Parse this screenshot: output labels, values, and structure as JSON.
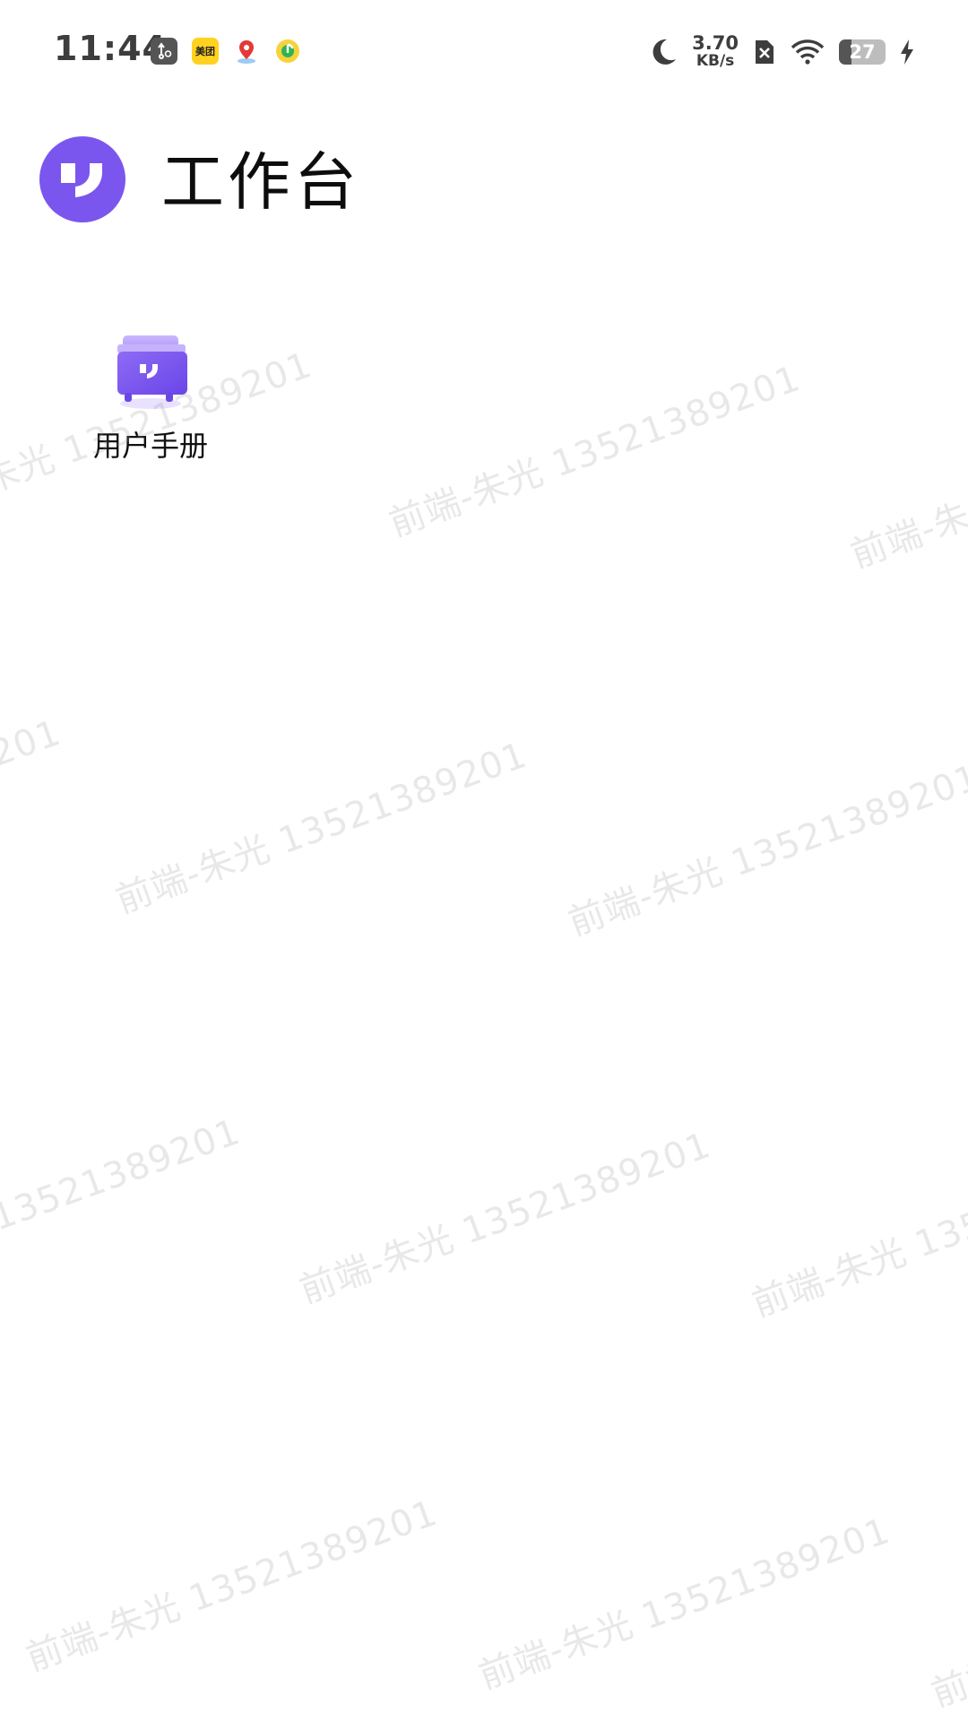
{
  "status_bar": {
    "time": "11:44",
    "left_icons": [
      "usb-settings-icon",
      "meituan-icon",
      "maps-icon",
      "qq-music-icon"
    ],
    "meituan_label": "美团",
    "network_speed_value": "3.70",
    "network_speed_unit": "KB/s",
    "battery_level": "27",
    "right_icons": [
      "moon-icon",
      "sim-disabled-icon",
      "wifi-icon",
      "battery-icon",
      "charging-icon"
    ]
  },
  "header": {
    "title": "工作台",
    "logo_color": "#7a56ee"
  },
  "apps": [
    {
      "label": "用户手册",
      "icon": "user-manual-icon"
    }
  ],
  "watermark": {
    "text": "前端-朱光 13521389201"
  },
  "colors": {
    "accent": "#7a56ee",
    "accent_light": "#b9a6fb",
    "text": "#111111",
    "status_text": "#3d3d3d"
  }
}
